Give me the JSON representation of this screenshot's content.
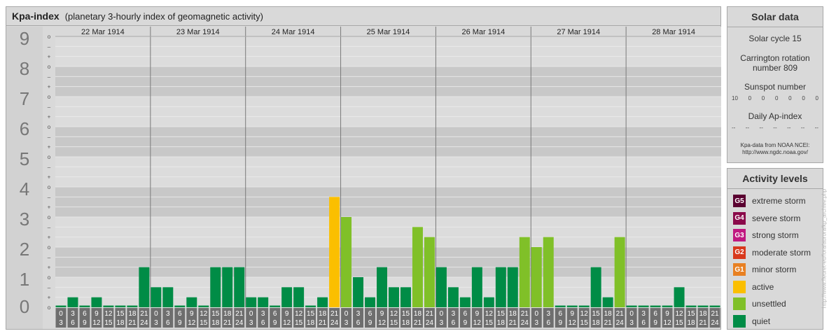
{
  "header": {
    "title": "Kpa-index",
    "subtitle": "(planetary 3-hourly index of geomagnetic activity)"
  },
  "chart_data": {
    "type": "bar",
    "title": "Kpa-index",
    "subtitle": "(planetary 3-hourly index of geomagnetic activity)",
    "ylim": [
      0,
      9
    ],
    "y_ticks": [
      "0",
      "1",
      "2",
      "3",
      "4",
      "5",
      "6",
      "7",
      "8",
      "9"
    ],
    "sub_ticks": [
      "o",
      "+",
      "–"
    ],
    "days": [
      "22 Mar 1914",
      "23 Mar 1914",
      "24 Mar 1914",
      "25 Mar 1914",
      "26 Mar 1914",
      "27 Mar 1914",
      "28 Mar 1914"
    ],
    "interval_start": [
      "0",
      "3",
      "6",
      "9",
      "12",
      "15",
      "18",
      "21"
    ],
    "interval_end": [
      "3",
      "6",
      "9",
      "12",
      "15",
      "18",
      "21",
      "24"
    ],
    "values": [
      0,
      0.333,
      0,
      0.333,
      0,
      0,
      0,
      1.333,
      0.667,
      0.667,
      0,
      0.333,
      0,
      1.333,
      1.333,
      1.333,
      0.333,
      0.333,
      0,
      0.667,
      0.667,
      0,
      0.333,
      3.667,
      3.0,
      1.0,
      0.333,
      1.333,
      0.667,
      0.667,
      2.667,
      2.333,
      1.333,
      0.667,
      0.333,
      1.333,
      0.333,
      1.333,
      1.333,
      2.333,
      2.0,
      2.333,
      0,
      0,
      0,
      1.333,
      0.333,
      2.333,
      0,
      0,
      0,
      0,
      0.667,
      0,
      0,
      0
    ],
    "categories": [
      "quiet",
      "unsettled",
      "active"
    ],
    "colors": {
      "quiet": "#008c46",
      "unsettled": "#80c028",
      "active": "#fbbf00"
    },
    "grid": true
  },
  "solar": {
    "title": "Solar data",
    "cycle": "Solar cycle 15",
    "carrington": "Carrington rotation number 809",
    "sunspot_label": "Sunspot number",
    "sunspot_values": [
      "10",
      "0",
      "0",
      "0",
      "0",
      "0",
      "0"
    ],
    "ap_label": "Daily Ap-index",
    "ap_values": [
      "--",
      "--",
      "--",
      "--",
      "--",
      "--",
      "--"
    ],
    "source_line1": "Kpa-data from NOAA NCEI:",
    "source_line2": "http://www.ngdc.noaa.gov/"
  },
  "activity": {
    "title": "Activity levels",
    "levels": [
      {
        "code": "G5",
        "label": "extreme storm",
        "color": "#5a0030"
      },
      {
        "code": "G4",
        "label": "severe storm",
        "color": "#8a0a4a"
      },
      {
        "code": "G3",
        "label": "strong storm",
        "color": "#c01880"
      },
      {
        "code": "G2",
        "label": "moderate storm",
        "color": "#d8381c"
      },
      {
        "code": "G1",
        "label": "minor storm",
        "color": "#e88022"
      },
      {
        "code": "",
        "label": "active",
        "color": "#fbbf00"
      },
      {
        "code": "",
        "label": "unsettled",
        "color": "#80c028"
      },
      {
        "code": "",
        "label": "quiet",
        "color": "#008c46"
      }
    ]
  },
  "watermark": "http://www.fleuret-eu/fora/aurora/kp_archive.php"
}
